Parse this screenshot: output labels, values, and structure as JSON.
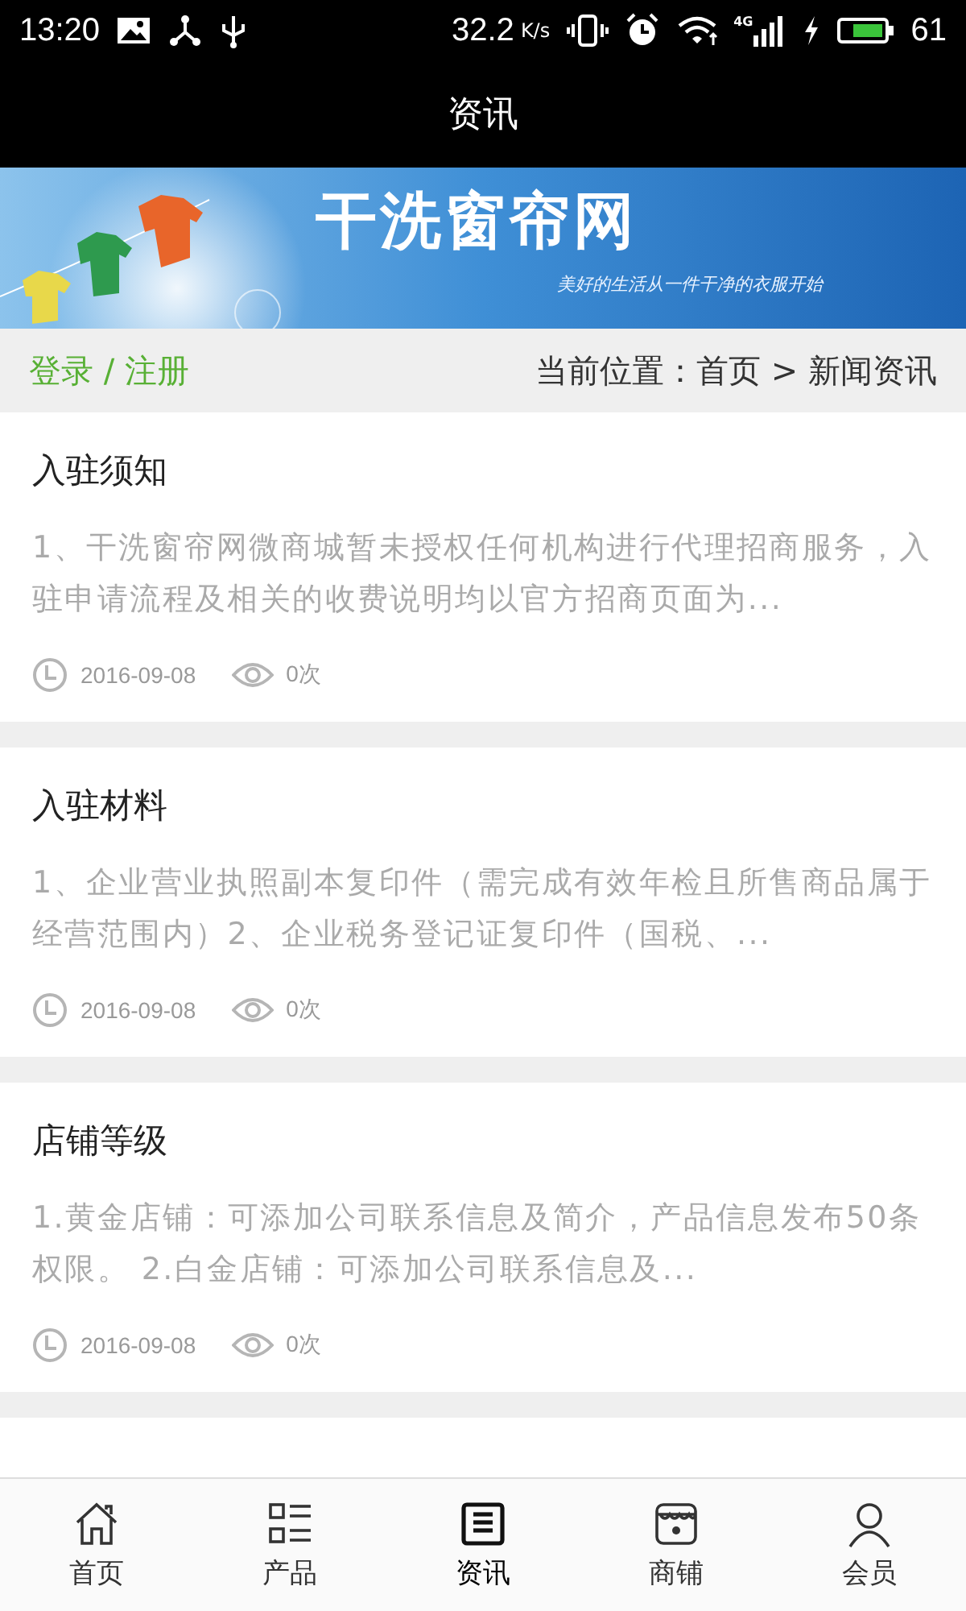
{
  "status_bar": {
    "time": "13:20",
    "speed": "32.2",
    "speed_unit": "K/s",
    "network": "4G",
    "battery": "61"
  },
  "header": {
    "title": "资讯"
  },
  "banner": {
    "kind": "picture",
    "title": "干洗窗帘网",
    "slogan": "美好的生活从一件干净的衣服开始"
  },
  "breadcrumb": {
    "login": "登录 / 注册",
    "location": "当前位置：首页 > 新闻资讯"
  },
  "articles": [
    {
      "title": "入驻须知",
      "summary": "1、干洗窗帘网微商城暂未授权任何机构进行代理招商服务，入驻申请流程及相关的收费说明均以官方招商页面为...",
      "date": "2016-09-08",
      "views": "0次"
    },
    {
      "title": "入驻材料",
      "summary": "1、企业营业执照副本复印件（需完成有效年检且所售商品属于经营范围内）2、企业税务登记证复印件（国税、...",
      "date": "2016-09-08",
      "views": "0次"
    },
    {
      "title": "店铺等级",
      "summary": "1.黄金店铺：可添加公司联系信息及简介，产品信息发布50条权限。 2.白金店铺：可添加公司联系信息及...",
      "date": "2016-09-08",
      "views": "0次"
    }
  ],
  "tabs": [
    {
      "label": "首页",
      "kind": "home",
      "selected": false
    },
    {
      "label": "产品",
      "kind": "list",
      "selected": false
    },
    {
      "label": "资讯",
      "kind": "news",
      "selected": true
    },
    {
      "label": "商铺",
      "kind": "shop",
      "selected": false
    },
    {
      "label": "会员",
      "kind": "user",
      "selected": false
    }
  ]
}
